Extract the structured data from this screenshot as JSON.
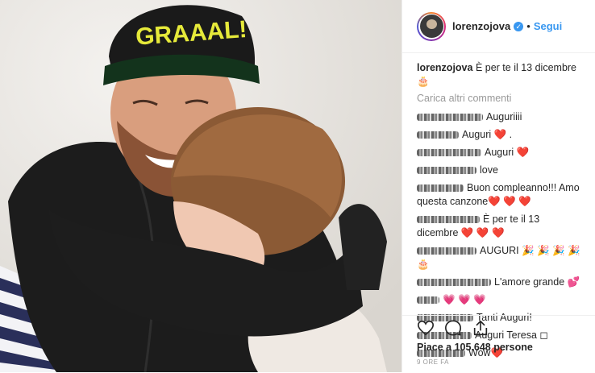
{
  "header": {
    "username": "lorenzojova",
    "separator": "•",
    "follow_label": "Segui"
  },
  "caption": {
    "username": "lorenzojova",
    "text": "È per te il 13 dicembre🎂"
  },
  "load_more_label": "Carica altri commenti",
  "comments": [
    {
      "blur_width": 82,
      "text": "Auguriiii"
    },
    {
      "blur_width": 52,
      "text": "Auguri ❤️ ."
    },
    {
      "blur_width": 80,
      "text": "Auguri ❤️"
    },
    {
      "blur_width": 74,
      "text": "love"
    },
    {
      "blur_width": 58,
      "text": "Buon compleanno!!! Amo questa canzone❤️ ❤️ ❤️"
    },
    {
      "blur_width": 78,
      "text": "È per te il 13 dicembre ❤️ ❤️ ❤️"
    },
    {
      "blur_width": 74,
      "text": "AUGURI 🎉 🎉 🎉 🎉 🎂"
    },
    {
      "blur_width": 92,
      "text": "L'amore grande 💕"
    },
    {
      "blur_width": 28,
      "text": "💗 💗 💗"
    },
    {
      "blur_width": 70,
      "text": "Tanti Auguri!"
    },
    {
      "blur_width": 68,
      "text": "Auguri Teresa ◻"
    },
    {
      "blur_width": 60,
      "text": "Wow❤️"
    }
  ],
  "actions": {
    "like_icon": "heart-icon",
    "comment_icon": "comment-icon",
    "share_icon": "share-icon"
  },
  "likes_text": "Piace a 105.648 persone",
  "timestamp": "9 ORE FA",
  "photo": {
    "cap_text": "GRAAAL!"
  }
}
